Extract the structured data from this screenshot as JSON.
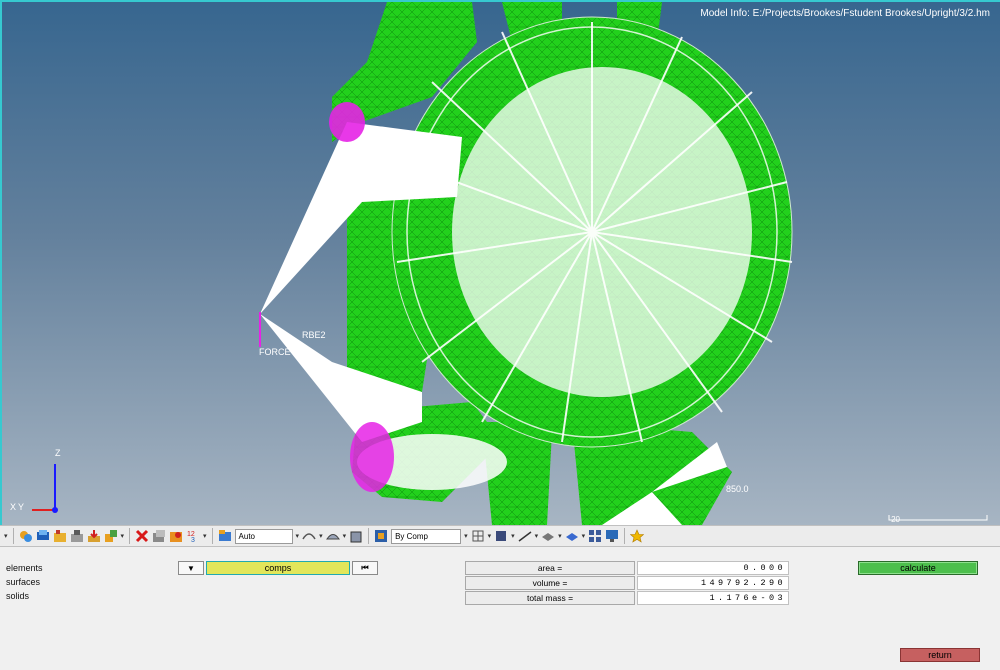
{
  "viewport": {
    "model_info": "Model Info: E:/Projects/Brookes/Fstudent Brookes/Upright/3/2.hm",
    "labels": {
      "rbe2": "RBE2",
      "force": "FORCE",
      "load_value": "850.0",
      "scale_number": "20"
    },
    "triad": {
      "z": "Z",
      "x": "X",
      "y": "Y"
    },
    "colors": {
      "mesh": "#22d11c",
      "rigid": "#ffffff",
      "constraint": "#e622e6",
      "bg_top": "#37668f",
      "bg_bottom": "#a7b5c3"
    }
  },
  "toolbar": {
    "icons": [
      "components-icon",
      "layers-icon",
      "organize-icon",
      "hide-icon",
      "import-icon",
      "component-color-icon",
      "delete-icon",
      "mask-icon",
      "unmask-icon",
      "numbers-icon",
      "display-mode-icon",
      "shading-icon",
      "wireframe-icon",
      "shaded-icon",
      "cube-icon",
      "by-comp-icon",
      "mesh-view-icon",
      "element-icon",
      "line-icon",
      "plane-icon",
      "visibility-icon",
      "grid-icon",
      "monitor-icon",
      "star-icon"
    ],
    "display_auto": "Auto",
    "color_mode": "By Comp"
  },
  "panel": {
    "entity_types": [
      "elements",
      "surfaces",
      "solids"
    ],
    "comps_label": "comps",
    "results": [
      {
        "label": "area    =",
        "value": "0.000"
      },
      {
        "label": "volume   =",
        "value": "149792.290"
      },
      {
        "label": "total mass =",
        "value": "1.176e-03"
      }
    ],
    "calculate_label": "calculate",
    "return_label": "return"
  }
}
